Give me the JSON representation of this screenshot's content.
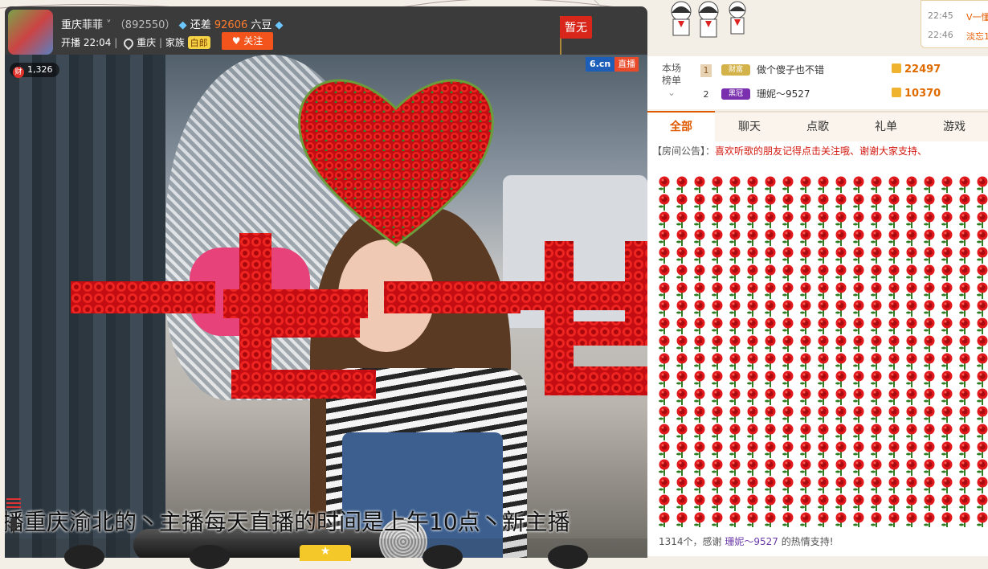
{
  "header": {
    "anchor_name": "重庆菲菲",
    "room_id": "（892550）",
    "still_need_label": "还差",
    "still_need_value": "92606",
    "currency": "六豆",
    "start_label": "开播 22:04",
    "location": "重庆",
    "family_label": "家族",
    "family_tag": "白郎",
    "follow_label": "关注",
    "flag_label": "暂无"
  },
  "video": {
    "gift_count": "1,326",
    "gift_coin_icon": "财",
    "logo": "6.cn",
    "live_tag": "直播",
    "marquee_text": "播重庆渝北的丶主播每天直播的时间是上午10点丶新主播"
  },
  "sidebar_chat": {
    "rows": [
      {
        "time": "22:45",
        "text": "Ⅴ一懂"
      },
      {
        "time": "22:46",
        "text": "淡忘1"
      }
    ]
  },
  "ranking": {
    "label_line1": "本场",
    "label_line2": "榜单",
    "entries": [
      {
        "rank": "1",
        "badge": "财富",
        "name": "做个傻子也不错",
        "score": "22497"
      },
      {
        "rank": "2",
        "badge": "黑冠",
        "name": "珊妮～9527",
        "score": "10370"
      }
    ]
  },
  "tabs": [
    "全部",
    "聊天",
    "点歌",
    "礼单",
    "游戏"
  ],
  "notice": {
    "label": "【房间公告】：",
    "message": "喜欢听歌的朋友记得点击关注哦、谢谢大家支持、"
  },
  "chat": {
    "gift_line_prefix": "1314个，感谢",
    "gift_line_name": "珊妮～9527",
    "gift_line_suffix": "的热情支持!"
  },
  "colors": {
    "accent": "#e05a00",
    "follow": "#f2541b",
    "rose": "#d9161a"
  }
}
